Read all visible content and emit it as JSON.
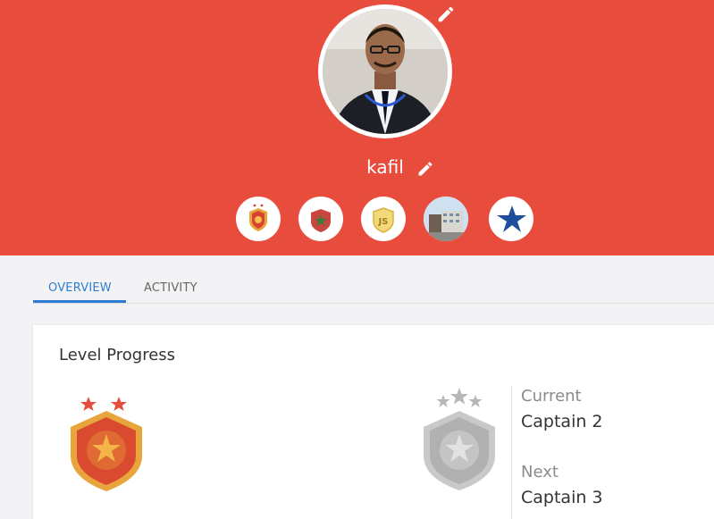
{
  "profile": {
    "username": "kafil",
    "avatar_icon": "profile-photo",
    "edit_avatar_icon": "pencil-icon",
    "edit_name_icon": "pencil-icon"
  },
  "badges": [
    {
      "name": "captain-shield-badge"
    },
    {
      "name": "morocco-shield-badge"
    },
    {
      "name": "javascript-badge"
    },
    {
      "name": "building-photo-badge"
    },
    {
      "name": "blue-star-badge"
    }
  ],
  "tabs": [
    {
      "label": "OVERVIEW",
      "active": true
    },
    {
      "label": "ACTIVITY",
      "active": false
    }
  ],
  "level_progress": {
    "title": "Level Progress",
    "current_label": "Current",
    "current_value": "Captain 2",
    "next_label": "Next",
    "next_value": "Captain 3"
  },
  "colors": {
    "header": "#e84c3d",
    "accent": "#2d7dd2",
    "badge_red": "#e84c3d",
    "badge_gold": "#e8a53b",
    "star_blue": "#1f4e9c"
  }
}
